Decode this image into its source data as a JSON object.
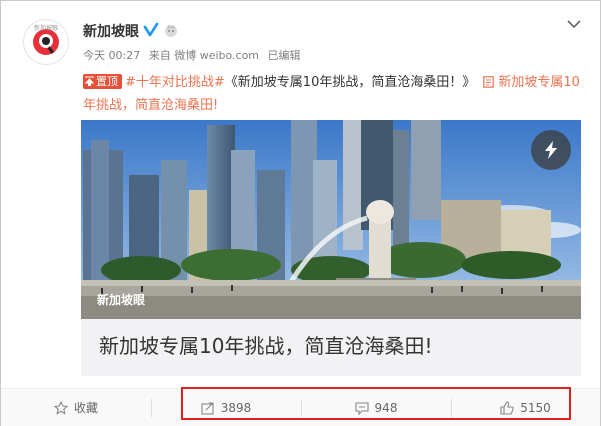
{
  "author": {
    "name": "新加坡眼",
    "avatar_caption": "新加坡眼"
  },
  "meta": {
    "time": "今天 00:27",
    "source": "来自 微博 weibo.com",
    "edited": "已编辑"
  },
  "post": {
    "pin_label": "置顶",
    "hashtag": "#十年对比挑战#",
    "body_text": "《新加坡专属10年挑战，简直沧海桑田！》",
    "link_title": "新加坡专属10年挑战，简直沧海桑田!"
  },
  "card": {
    "image_label": "新加坡眼",
    "title": "新加坡专属10年挑战，简直沧海桑田!"
  },
  "actions": {
    "favorite_label": "收藏",
    "repost_count": "3898",
    "comment_count": "948",
    "like_count": "5150"
  },
  "colors": {
    "accent": "#eb7350",
    "pin_bg": "#e8503a",
    "verified": "#1d9bf0",
    "highlight": "#e02020"
  }
}
